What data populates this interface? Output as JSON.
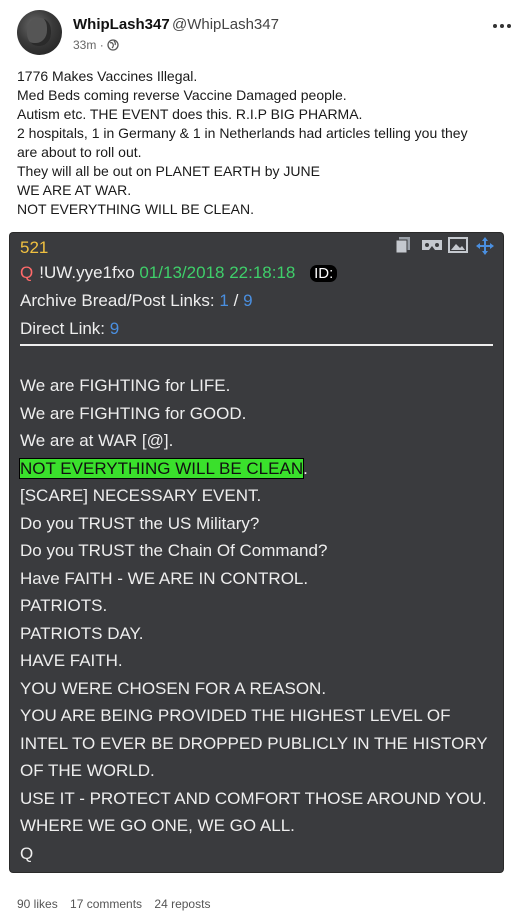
{
  "post": {
    "author_name": "WhipLash347",
    "author_handle": "@WhipLash347",
    "time": "33m",
    "text_lines": [
      "1776 Makes Vaccines Illegal.",
      "Med Beds coming reverse Vaccine Damaged people.",
      "Autism etc. THE EVENT does this. R.I.P BIG PHARMA.",
      "2 hospitals, 1 in Germany & 1 in Netherlands had articles telling you they",
      "are about to roll out.",
      "They will all be out on PLANET EARTH by JUNE",
      "WE ARE AT WAR.",
      "NOT EVERYTHING WILL BE CLEAN."
    ]
  },
  "qdrop": {
    "number": "521",
    "q_marker": "Q",
    "tripcode": "!UW.yye1fxo",
    "datetime": "01/13/2018 22:18:18",
    "id_label": "ID:",
    "archive_label": "Archive Bread/Post Links:",
    "archive_link_1": "1",
    "archive_sep": "/",
    "archive_link_2": "9",
    "direct_label": "Direct Link:",
    "direct_link": "9",
    "lines": [
      "We are FIGHTING for LIFE.",
      "We are FIGHTING for GOOD.",
      "We are at WAR [@].",
      "",
      "[SCARE] NECESSARY EVENT.",
      "Do you TRUST the US Military?",
      "Do you TRUST the Chain Of Command?",
      "Have FAITH - WE ARE IN CONTROL.",
      "PATRIOTS.",
      "PATRIOTS DAY.",
      "HAVE FAITH.",
      "YOU WERE CHOSEN FOR A REASON.",
      "YOU ARE BEING PROVIDED THE HIGHEST LEVEL OF",
      "INTEL TO EVER BE DROPPED PUBLICLY IN THE HISTORY",
      "OF THE WORLD.",
      "USE IT - PROTECT AND COMFORT THOSE AROUND YOU.",
      "WHERE WE GO ONE, WE GO ALL.",
      "Q"
    ],
    "highlighted_text": "NOT EVERYTHING WILL BE CLEAN",
    "highlighted_suffix": ".",
    "highlight_color": "#3ae02c"
  },
  "stats": {
    "likes": "90 likes",
    "comments": "17 comments",
    "reposts": "24 reposts"
  },
  "icons": [
    "globe-icon",
    "more-options-icon",
    "copy-icon",
    "vr-icon",
    "image-icon",
    "move-icon"
  ]
}
